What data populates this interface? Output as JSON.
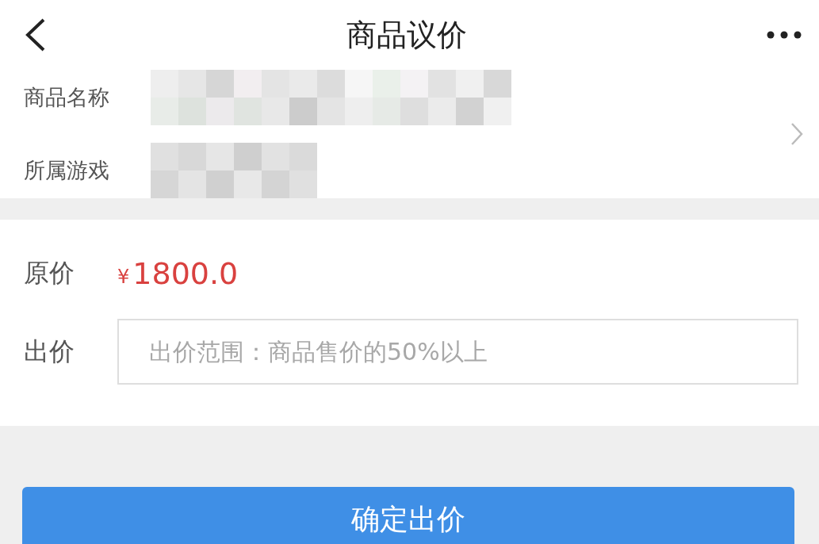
{
  "header": {
    "title": "商品议价"
  },
  "product": {
    "rows": [
      {
        "label": "商品名称"
      },
      {
        "label": "所属游戏"
      }
    ]
  },
  "price": {
    "label": "原价",
    "currency": "¥",
    "amount": "1800.0"
  },
  "offer": {
    "label": "出价",
    "placeholder": "出价范围：商品售价的50%以上"
  },
  "submit": {
    "label": "确定出价"
  }
}
